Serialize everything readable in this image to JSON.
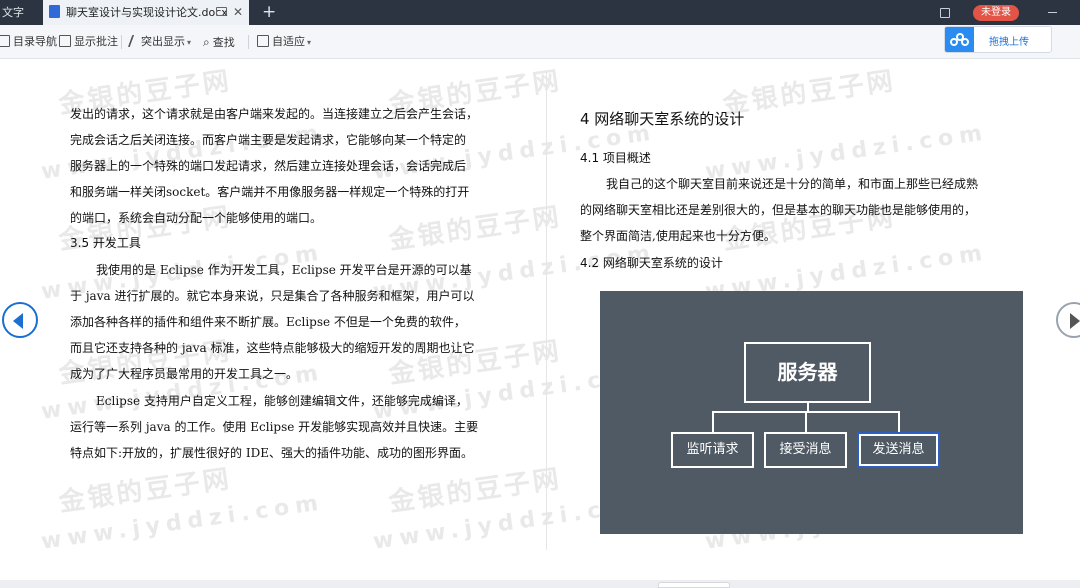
{
  "window": {
    "left_tab_label": "文字",
    "doc_tab_title": "聊天室设计与实现设计论文.docx",
    "new_tab_symbol": "+",
    "login_label": "未登录"
  },
  "toolbar": {
    "nav_label": "目录导航",
    "comments_label": "显示批注",
    "highlight_label": "突出显示",
    "find_label": "查找",
    "fit_label": "自适应",
    "upload_label": "拖拽上传"
  },
  "left_page": {
    "para1": [
      "发出的请求，这个请求就是由客户端来发起的。当连接建立之后会产生会话，",
      "完成会话之后关闭连接。而客户端主要是发起请求，它能够向某一个特定的",
      "服务器上的一个特殊的端口发起请求，然后建立连接处理会话，会话完成后",
      "和服务端一样关闭socket。客户端并不用像服务器一样规定一个特殊的打开",
      "的端口，系统会自动分配一个能够使用的端口。"
    ],
    "heading_3_5": "3.5 开发工具",
    "para2": [
      "我使用的是 Eclipse 作为开发工具，Eclipse 开发平台是开源的可以基",
      "于 java 进行扩展的。就它本身来说，只是集合了各种服务和框架，用户可以",
      "添加各种各样的插件和组件来不断扩展。Eclipse 不但是一个免费的软件，",
      "而且它还支持各种的 java 标准，这些特点能够极大的缩短开发的周期也让它",
      "成为了广大程序员最常用的开发工具之一。"
    ],
    "para3": [
      "Eclipse 支持用户自定义工程，能够创建编辑文件，还能够完成编译，",
      "运行等一系列 java 的工作。使用 Eclipse 开发能够实现高效并且快速。主要",
      "特点如下:开放的，扩展性很好的 IDE、强大的插件功能、成功的图形界面。"
    ]
  },
  "right_page": {
    "chapter_title": "4 网络聊天室系统的设计",
    "heading_4_1": "4.1 项目概述",
    "para_4_1": [
      "我自己的这个聊天室目前来说还是十分的简单，和市面上那些已经成熟",
      "的网络聊天室相比还是差别很大的，但是基本的聊天功能也是能够使用的，",
      "整个界面简洁,使用起来也十分方便。"
    ],
    "heading_4_2": "4.2 网络聊天室系统的设计",
    "diagram": {
      "root": "服务器",
      "children": [
        "监听请求",
        "接受消息",
        "发送消息"
      ]
    }
  },
  "watermark": {
    "cn": "金银的豆子网",
    "en": "www.jyddzi.com"
  },
  "colors": {
    "accent": "#1a6fd1",
    "login_badge": "#e25546",
    "diagram_bg": "#4f5a64"
  }
}
